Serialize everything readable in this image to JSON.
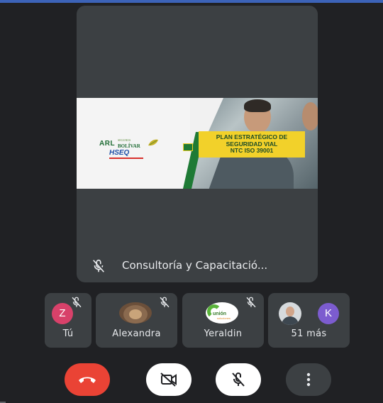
{
  "main_tile": {
    "participant_name": "Consultoría y Capacitació...",
    "mic_state": "muted",
    "presentation": {
      "brand_arl": "ARL",
      "brand_seguros": "SEGUROS",
      "brand_bolivar": "BOLÍVAR",
      "brand_hseq": "HSEQ",
      "title_line1": "PLAN ESTRATÉGICO DE",
      "title_line2": "SEGURIDAD VIAL",
      "title_line3": "NTC ISO 39001"
    }
  },
  "participants": [
    {
      "name": "Tú",
      "avatar_letter": "Z",
      "avatar_color": "#d8416a",
      "muted": true
    },
    {
      "name": "Alexandra",
      "avatar": "photo-cat",
      "muted": true
    },
    {
      "name": "Yeraldin",
      "avatar": "photo-logo",
      "logo_text": "unión",
      "logo_sub": "soluciones",
      "muted": true
    },
    {
      "name": "51 más",
      "avatar_letter": "K",
      "avatar_color": "#7c5ccf",
      "muted": false
    }
  ],
  "controls": [
    {
      "id": "end-call",
      "icon": "phone-hangup-icon",
      "color": "#ea4335"
    },
    {
      "id": "camera",
      "icon": "camera-off-icon",
      "color": "#ffffff"
    },
    {
      "id": "microphone",
      "icon": "mic-off-icon",
      "color": "#ffffff"
    },
    {
      "id": "more",
      "icon": "more-vert-icon",
      "color": "#3c4043"
    }
  ],
  "colors": {
    "background": "#202124",
    "tile": "#3c4043",
    "top_bar": "#3c63b8"
  }
}
